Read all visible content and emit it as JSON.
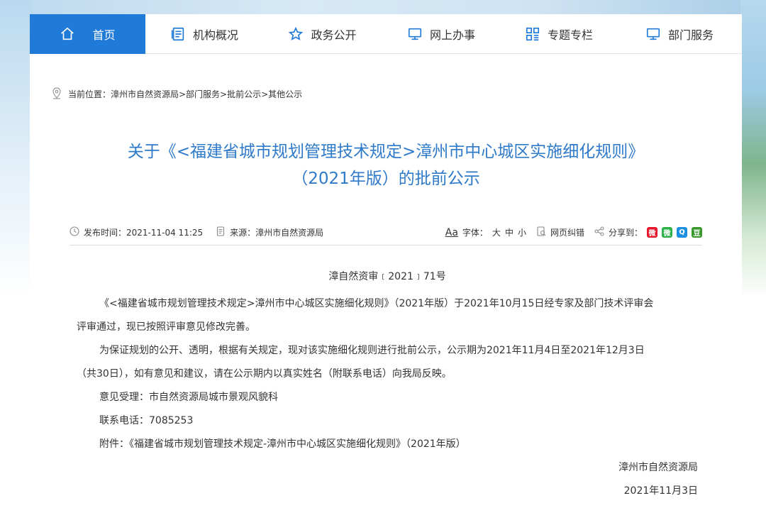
{
  "nav": {
    "items": [
      {
        "label": "首页",
        "icon": "home-icon"
      },
      {
        "label": "机构概况",
        "icon": "list-icon"
      },
      {
        "label": "政务公开",
        "icon": "star-icon"
      },
      {
        "label": "网上办事",
        "icon": "monitor-icon"
      },
      {
        "label": "专题专栏",
        "icon": "grid-icon"
      },
      {
        "label": "部门服务",
        "icon": "monitor-icon"
      }
    ],
    "active_color": "#1f7ad8"
  },
  "breadcrumb": {
    "icon": "location-icon",
    "text": "当前位置：漳州市自然资源局>部门服务>批前公示>其他公示"
  },
  "article": {
    "title_line1": "关于《<福建省城市规划管理技术规定>漳州市中心城区实施细化规则》",
    "title_line2": "（2021年版）的批前公示",
    "title_color": "#2f7ac9",
    "meta": {
      "publish_label": "发布时间：2021-11-04 11:25",
      "source_label": "来源：漳州市自然资源局",
      "font_aa": "Aa",
      "font_label": "字体：",
      "font_large": "大",
      "font_medium": "中",
      "font_small": "小",
      "correct_label": "网页纠错",
      "share_label": "分享到："
    },
    "doc_number": "漳自然资审﹝2021﹞71号",
    "paragraphs": [
      "《<福建省城市规划管理技术规定>漳州市中心城区实施细化规则》（2021年版）于2021年10月15日经专家及部门技术评审会",
      "评审通过，现已按照评审意见修改完善。",
      "为保证规划的公开、透明，根据有关规定，现对该实施细化规则进行批前公示，公示期为2021年11月4日至2021年12月3日",
      "（共30日），如有意见和建议，请在公示期内以真实姓名（附联系电话）向我局反映。",
      "意见受理：市自然资源局城市景观风貌科",
      "联系电话：7085253",
      "附件：《福建省城市规划管理技术规定-漳州市中心城区实施细化规则》（2021年版）"
    ],
    "signature": "漳州市自然资源局",
    "date": "2021年11月3日"
  }
}
